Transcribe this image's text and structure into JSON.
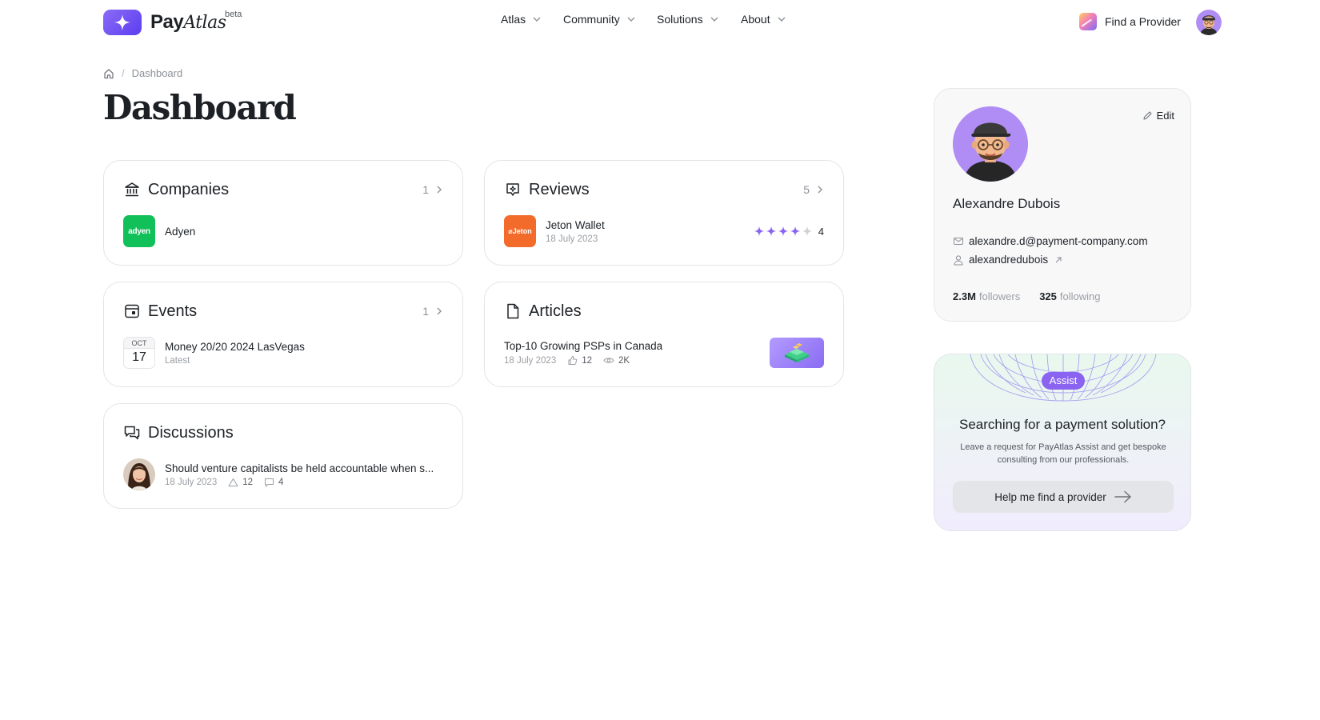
{
  "header": {
    "brand_pay": "Pay",
    "brand_atlas": "Atlas",
    "brand_beta": "beta",
    "nav": [
      {
        "label": "Atlas"
      },
      {
        "label": "Community"
      },
      {
        "label": "Solutions"
      },
      {
        "label": "About"
      }
    ],
    "find_provider": "Find a Provider"
  },
  "breadcrumb": {
    "current": "Dashboard",
    "separator": "/"
  },
  "page_title": "Dashboard",
  "companies": {
    "title": "Companies",
    "count": "1",
    "item": {
      "logo_text": "adyen",
      "name": "Adyen"
    }
  },
  "reviews": {
    "title": "Reviews",
    "count": "5",
    "item": {
      "logo_text": "⌀Jeton",
      "name": "Jeton Wallet",
      "date": "18 July 2023",
      "rating": "4",
      "stars_filled": 4,
      "stars_total": 5
    }
  },
  "events": {
    "title": "Events",
    "count": "1",
    "item": {
      "month": "OCT",
      "day": "17",
      "name": "Money 20/20 2024 LasVegas",
      "tag": "Latest"
    }
  },
  "articles": {
    "title": "Articles",
    "item": {
      "name": "Top-10 Growing PSPs in Canada",
      "date": "18 July 2023",
      "likes": "12",
      "views": "2K"
    }
  },
  "discussions": {
    "title": "Discussions",
    "item": {
      "name": "Should venture capitalists be held accountable when s...",
      "date": "18 July 2023",
      "votes": "12",
      "comments": "4"
    }
  },
  "profile": {
    "edit": "Edit",
    "name": "Alexandre Dubois",
    "email": "alexandre.d@payment-company.com",
    "handle": "alexandredubois",
    "followers_count": "2.3M",
    "followers_label": "followers",
    "following_count": "325",
    "following_label": "following"
  },
  "assist": {
    "badge": "Assist",
    "title": "Searching for a payment solution?",
    "subtitle": "Leave a request for PayAtlas Assist and get bespoke consulting from our professionals.",
    "button": "Help me find a provider"
  },
  "colors": {
    "brand": "#6b4ef2",
    "assist_badge": "#8a63f0",
    "star": "#8a63f0",
    "adyen": "#12c05a",
    "jeton": "#f26b2a"
  }
}
